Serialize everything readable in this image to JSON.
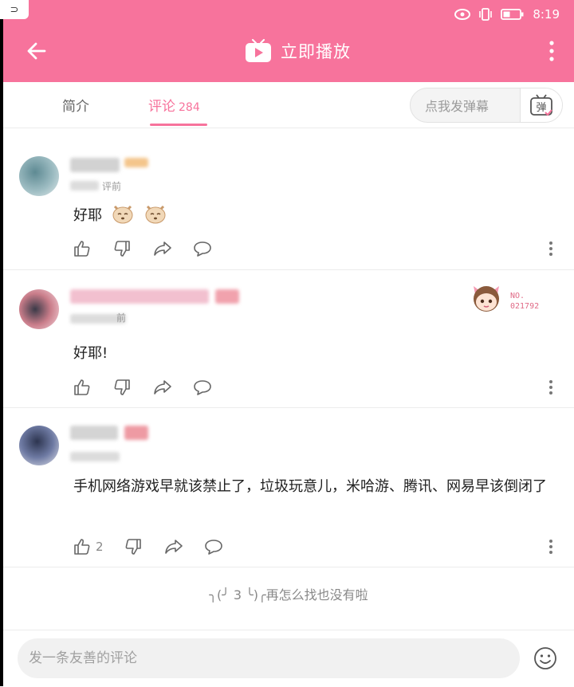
{
  "status": {
    "time": "8:19",
    "icons": [
      "eye-icon",
      "vibrate-icon",
      "battery-icon"
    ]
  },
  "header": {
    "play_label": "立即播放",
    "accent": "#f7739c"
  },
  "tabs": [
    {
      "label": "简介",
      "active": false
    },
    {
      "label": "评论",
      "count": "284",
      "active": true
    }
  ],
  "danmaku": {
    "placeholder": "点我发弹幕",
    "button_label": "弹"
  },
  "comments": [
    {
      "time_suffix": "评前",
      "text": "好耶",
      "emoji": "dog-face-icon",
      "likes": ""
    },
    {
      "time_suffix": "前",
      "text": "好耶!",
      "medal": {
        "label": "NO.",
        "number": "021792"
      },
      "likes": ""
    },
    {
      "time_suffix": "",
      "text": "手机网络游戏早就该禁止了，垃圾玩意儿，米哈游、腾讯、网易早该倒闭了",
      "likes": "2"
    }
  ],
  "footer": {
    "end_text": "╮(╯ 3 ╰)╭再怎么找也没有啦"
  },
  "bottom": {
    "input_placeholder": "发一条友善的评论"
  }
}
